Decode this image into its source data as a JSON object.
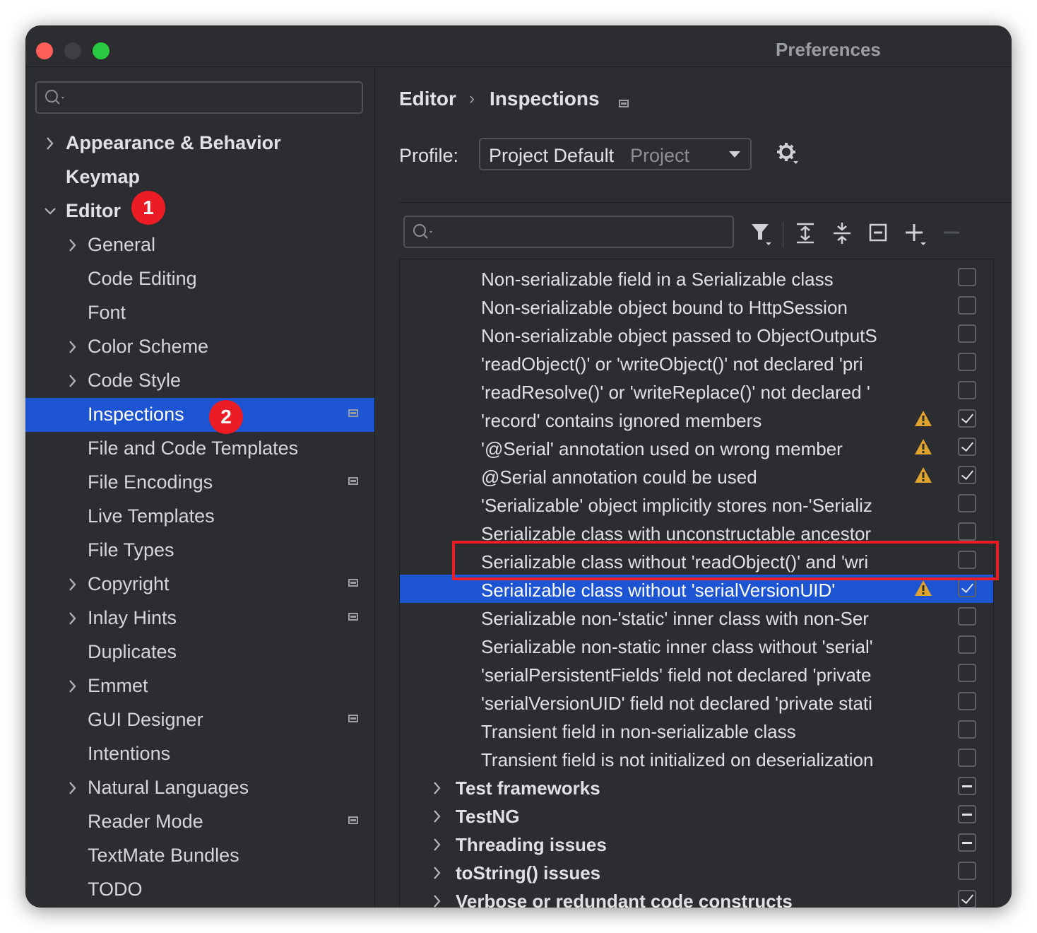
{
  "window": {
    "title": "Preferences",
    "traffic_lights": {
      "close": "#ff5f57",
      "minimize": "#3d3f43",
      "zoom": "#28c840"
    }
  },
  "sidebar": {
    "search": {
      "placeholder": "",
      "icon": "search-icon"
    },
    "items": [
      {
        "label": "Appearance & Behavior",
        "level": 0,
        "expandable": true,
        "expanded": false
      },
      {
        "label": "Keymap",
        "level": 0,
        "expandable": false
      },
      {
        "label": "Editor",
        "level": 0,
        "expandable": true,
        "expanded": true
      },
      {
        "label": "General",
        "level": 1,
        "expandable": true
      },
      {
        "label": "Code Editing",
        "level": 1
      },
      {
        "label": "Font",
        "level": 1
      },
      {
        "label": "Color Scheme",
        "level": 1,
        "expandable": true
      },
      {
        "label": "Code Style",
        "level": 1,
        "expandable": true
      },
      {
        "label": "Inspections",
        "level": 1,
        "selected": true,
        "project_icon": true
      },
      {
        "label": "File and Code Templates",
        "level": 1
      },
      {
        "label": "File Encodings",
        "level": 1,
        "project_icon": true
      },
      {
        "label": "Live Templates",
        "level": 1
      },
      {
        "label": "File Types",
        "level": 1
      },
      {
        "label": "Copyright",
        "level": 1,
        "expandable": true,
        "project_icon": true
      },
      {
        "label": "Inlay Hints",
        "level": 1,
        "expandable": true,
        "project_icon": true
      },
      {
        "label": "Duplicates",
        "level": 1
      },
      {
        "label": "Emmet",
        "level": 1,
        "expandable": true
      },
      {
        "label": "GUI Designer",
        "level": 1,
        "project_icon": true
      },
      {
        "label": "Intentions",
        "level": 1
      },
      {
        "label": "Natural Languages",
        "level": 1,
        "expandable": true
      },
      {
        "label": "Reader Mode",
        "level": 1,
        "project_icon": true
      },
      {
        "label": "TextMate Bundles",
        "level": 1
      },
      {
        "label": "TODO",
        "level": 1
      }
    ]
  },
  "annotations": {
    "badge1": "1",
    "badge2": "2",
    "color": "#ec1c24"
  },
  "main": {
    "breadcrumb": {
      "first": "Editor",
      "separator": "›",
      "second": "Inspections"
    },
    "profile": {
      "label": "Profile:",
      "value": "Project Default",
      "scope": "Project"
    },
    "toolbar": [
      "filter-icon",
      "expand-all-icon",
      "collapse-all-icon",
      "reset-icon",
      "add-icon",
      "remove-icon"
    ],
    "list_search": {
      "placeholder": ""
    },
    "rows": [
      {
        "text": "Non-serializable field in a Serializable class",
        "checked": "off"
      },
      {
        "text": "Non-serializable object bound to HttpSession",
        "checked": "off"
      },
      {
        "text": "Non-serializable object passed to ObjectOutputS",
        "checked": "off"
      },
      {
        "text": "'readObject()' or 'writeObject()' not declared 'pri",
        "checked": "off"
      },
      {
        "text": "'readResolve()' or 'writeReplace()' not declared '",
        "checked": "off"
      },
      {
        "text": "'record' contains ignored members",
        "checked": "on",
        "warning": true
      },
      {
        "text": "'@Serial' annotation used on wrong member",
        "checked": "on",
        "warning": true
      },
      {
        "text": "@Serial annotation could be used",
        "checked": "on",
        "warning": true
      },
      {
        "text": "'Serializable' object implicitly stores non-'Serializ",
        "checked": "off"
      },
      {
        "text": "Serializable class with unconstructable ancestor",
        "checked": "off"
      },
      {
        "text": "Serializable class without 'readObject()' and 'wri",
        "checked": "off"
      },
      {
        "text": "Serializable class without 'serialVersionUID'",
        "checked": "on",
        "warning": true,
        "selected": true
      },
      {
        "text": "Serializable non-'static' inner class with non-Ser",
        "checked": "off"
      },
      {
        "text": "Serializable non-static inner class without 'serial'",
        "checked": "off"
      },
      {
        "text": "'serialPersistentFields' field not declared 'private",
        "checked": "off"
      },
      {
        "text": "'serialVersionUID' field not declared 'private stati",
        "checked": "off"
      },
      {
        "text": "Transient field in non-serializable class",
        "checked": "off"
      },
      {
        "text": "Transient field is not initialized on deserialization",
        "checked": "off"
      },
      {
        "text": "Test frameworks",
        "category": true,
        "checked": "partial"
      },
      {
        "text": "TestNG",
        "category": true,
        "checked": "partial"
      },
      {
        "text": "Threading issues",
        "category": true,
        "checked": "partial"
      },
      {
        "text": "toString() issues",
        "category": true,
        "checked": "off"
      },
      {
        "text": "Verbose or redundant code constructs",
        "category": true,
        "checked": "on"
      }
    ]
  },
  "colors": {
    "selection": "#1d54d1",
    "warning": "#e0a32e",
    "background": "#2b2d30"
  }
}
